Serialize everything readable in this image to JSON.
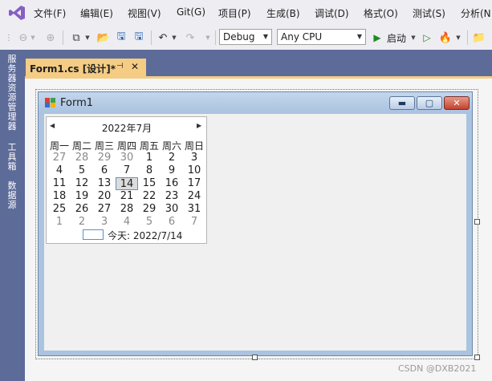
{
  "menu": {
    "items": [
      "文件(F)",
      "编辑(E)",
      "视图(V)",
      "Git(G)",
      "项目(P)",
      "生成(B)",
      "调试(D)",
      "格式(O)",
      "测试(S)",
      "分析(N"
    ]
  },
  "toolbar": {
    "config": "Debug",
    "platform": "Any CPU",
    "start_label": "启动"
  },
  "left_tabs": [
    "服务器资源管理器",
    "工具箱",
    "数据源"
  ],
  "document_tab": {
    "label": "Form1.cs [设计]*",
    "pin": "⊣",
    "close": "✕"
  },
  "form": {
    "title": "Form1",
    "min_glyph": "▬",
    "max_glyph": "▢",
    "close_glyph": "✕"
  },
  "calendar": {
    "prev": "◀",
    "next": "▶",
    "month_label": "2022年7月",
    "weekdays": [
      "周一",
      "周二",
      "周三",
      "周四",
      "周五",
      "周六",
      "周日"
    ],
    "weeks": [
      [
        "27",
        "28",
        "29",
        "30",
        "1",
        "2",
        "3"
      ],
      [
        "4",
        "5",
        "6",
        "7",
        "8",
        "9",
        "10"
      ],
      [
        "11",
        "12",
        "13",
        "14",
        "15",
        "16",
        "17"
      ],
      [
        "18",
        "19",
        "20",
        "21",
        "22",
        "23",
        "24"
      ],
      [
        "25",
        "26",
        "27",
        "28",
        "29",
        "30",
        "31"
      ],
      [
        "1",
        "2",
        "3",
        "4",
        "5",
        "6",
        "7"
      ]
    ],
    "today_label": "今天: 2022/7/14"
  },
  "watermark": "CSDN @DXB2021",
  "colors": {
    "chrome_bg": "#eeeef2",
    "frame_bg": "#5d6b99",
    "active_tab": "#f5cc84",
    "designer_bg": "#f5f5f5",
    "vs_purple": "#865fc5",
    "start_green": "#1e8c1e"
  }
}
